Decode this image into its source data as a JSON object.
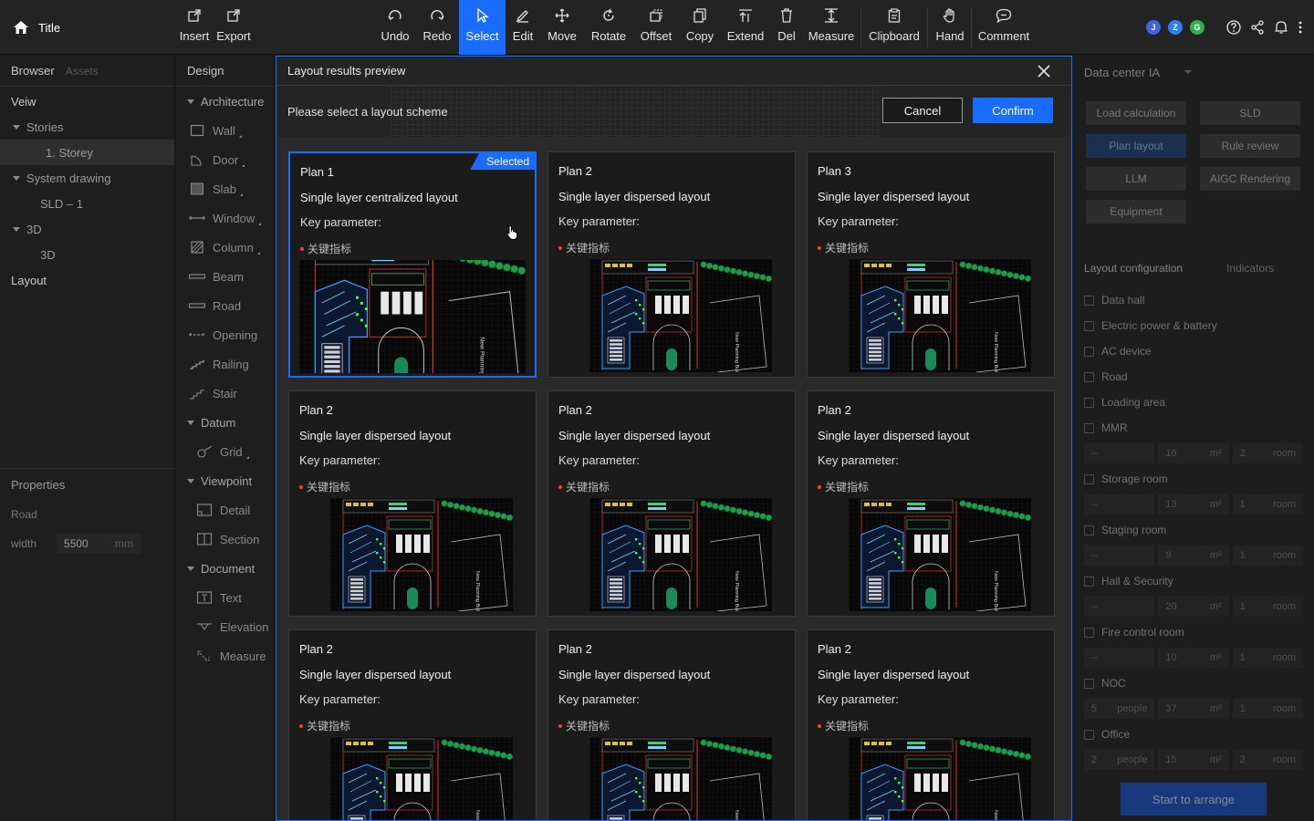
{
  "app": {
    "title": "Title"
  },
  "toolbar": {
    "tools": [
      {
        "id": "insert",
        "label": "Insert"
      },
      {
        "id": "export",
        "label": "Export"
      },
      {
        "id": "undo",
        "label": "Undo"
      },
      {
        "id": "redo",
        "label": "Redo"
      },
      {
        "id": "select",
        "label": "Select",
        "active": true
      },
      {
        "id": "edit",
        "label": "Edit"
      },
      {
        "id": "move",
        "label": "Move"
      },
      {
        "id": "rotate",
        "label": "Rotate"
      },
      {
        "id": "offset",
        "label": "Offset"
      },
      {
        "id": "copy",
        "label": "Copy"
      },
      {
        "id": "extend",
        "label": "Extend"
      },
      {
        "id": "del",
        "label": "Del"
      },
      {
        "id": "measure",
        "label": "Measure"
      },
      {
        "id": "clipboard",
        "label": "Clipboard"
      },
      {
        "id": "hand",
        "label": "Hand"
      },
      {
        "id": "comment",
        "label": "Comment"
      }
    ],
    "avatars": [
      {
        "letter": "J",
        "color": "#3f62e8"
      },
      {
        "letter": "Z",
        "color": "#2f7ef0"
      },
      {
        "letter": "G",
        "color": "#2fb24a"
      }
    ],
    "accent": "#1a6cff"
  },
  "browser": {
    "tab_browser": "Browser",
    "tab_assets": "Assets",
    "view_label": "Veiw",
    "stories_label": "Stories",
    "storey_item": "1. Storey",
    "system_drawing_label": "System drawing",
    "sld_item": "SLD – 1",
    "three_d_label": "3D",
    "three_d_item": "3D",
    "layout_label": "Layout"
  },
  "properties": {
    "title": "Properties",
    "object": "Road",
    "width_label": "width",
    "width_value": "5500",
    "width_unit": "mm"
  },
  "design": {
    "title": "Design",
    "architecture": "Architecture",
    "wall": "Wall",
    "door": "Door",
    "slab": "Slab",
    "window": "Window",
    "column": "Column",
    "beam": "Beam",
    "road": "Road",
    "opening": "Opening",
    "railing": "Railing",
    "stair": "Stair",
    "datum": "Datum",
    "grid": "Grid",
    "viewpoint": "Viewpoint",
    "detail": "Detail",
    "section": "Section",
    "document": "Document",
    "text": "Text",
    "elevation": "Elevation",
    "measure": "Measure"
  },
  "modal": {
    "title": "Layout results preview",
    "instruction": "Please select a layout scheme",
    "cancel": "Cancel",
    "confirm": "Confirm",
    "selected_badge": "Selected",
    "key_parameter": "Key parameter:",
    "indicator": "关键指标",
    "plans": [
      {
        "name": "Plan 1",
        "type": "Single layer centralized layout",
        "selected": true
      },
      {
        "name": "Plan 2",
        "type": "Single layer dispersed layout"
      },
      {
        "name": "Plan 3",
        "type": "Single layer dispersed layout"
      },
      {
        "name": "Plan 2",
        "type": "Single layer dispersed layout"
      },
      {
        "name": "Plan 2",
        "type": "Single layer dispersed layout"
      },
      {
        "name": "Plan 2",
        "type": "Single layer dispersed layout"
      },
      {
        "name": "Plan 2",
        "type": "Single layer dispersed layout"
      },
      {
        "name": "Plan 2",
        "type": "Single layer dispersed layout"
      },
      {
        "name": "Plan 2",
        "type": "Single layer dispersed layout"
      }
    ],
    "thumb_caption": "New Planning Building"
  },
  "datacenter": {
    "title": "Data center IA",
    "buttons": {
      "load_calc": "Load calculation",
      "sld": "SLD",
      "plan_layout": "Plan layout",
      "rule_review": "Rule review",
      "llm": "LLM",
      "aigc": "AIGC Rendering",
      "equipment": "Equipment"
    },
    "tab_config": "Layout configuration",
    "tab_indicators": "Indicators",
    "items": {
      "data_hall": "Data hall",
      "electric": "Electric power & battery",
      "ac": "AC device",
      "road": "Road",
      "loading": "Loading area",
      "mmr": "MMR",
      "storage": "Storage room",
      "staging": "Staging room",
      "hall_security": "Hall & Security",
      "fire": "Fire control room",
      "noc": "NOC",
      "office": "Office"
    },
    "rows": {
      "mmr": {
        "a": "--",
        "b": "16",
        "c": "2"
      },
      "storage": {
        "a": "--",
        "b": "13",
        "c": "1"
      },
      "staging": {
        "a": "--",
        "b": "9",
        "c": "1"
      },
      "hall_security": {
        "a": "--",
        "b": "20",
        "c": "1"
      },
      "fire": {
        "a": "--",
        "b": "10",
        "c": "1"
      },
      "noc": {
        "a": "5",
        "b": "37",
        "c": "1"
      },
      "office": {
        "a": "2",
        "b": "15",
        "c": "2"
      }
    },
    "unit_people": "people",
    "unit_area": "m²",
    "unit_room": "room",
    "start_button": "Start to arrange"
  }
}
